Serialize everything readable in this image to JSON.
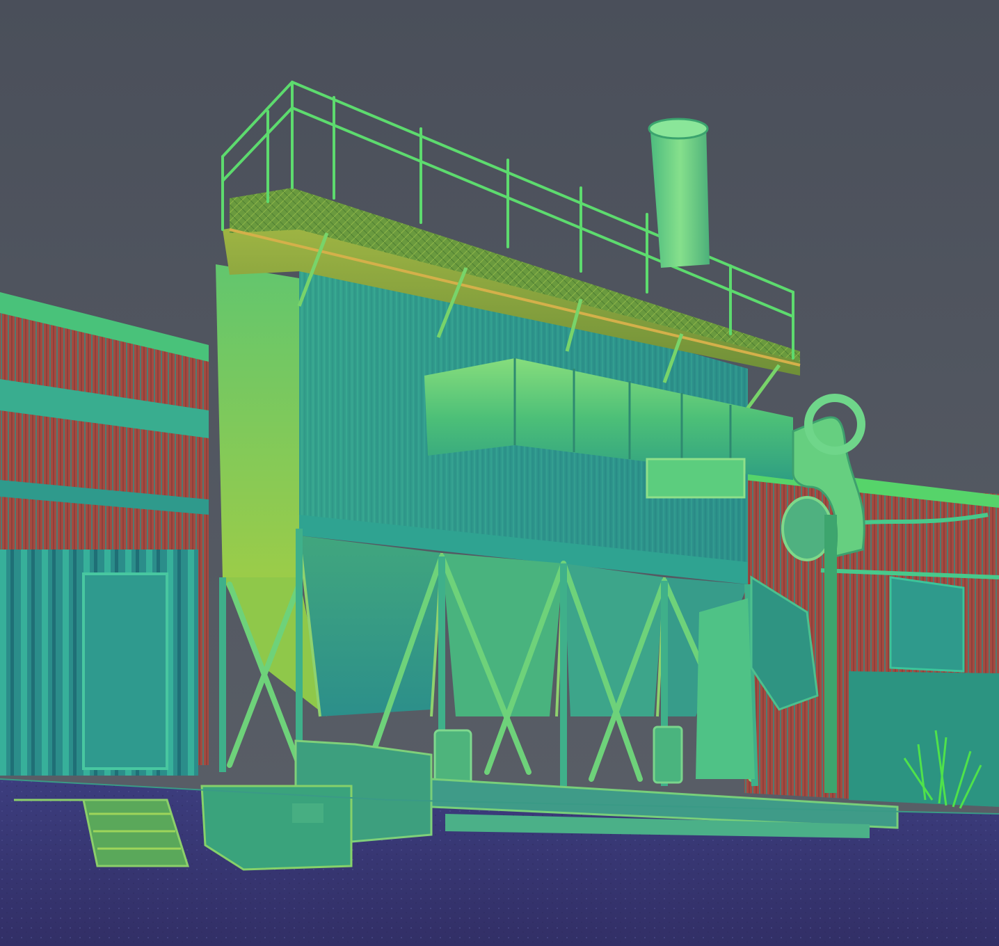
{
  "viewer": {
    "background_top": "#4b4f59",
    "background_bottom": "#5a5f68"
  },
  "scene": {
    "description_palette": {
      "ground": "#35336e",
      "ground_light": "#3e3f82",
      "wall_red": "#a8463e",
      "wall_red_dark": "#8e3a36",
      "panel_teal": "#2f9b8e",
      "panel_teal_dark": "#227a78",
      "structure_green": "#45c46a",
      "structure_light": "#7be07a",
      "rail_green": "#55d36a",
      "hopper_yellow": "#9fcf3a",
      "duct_green": "#5fd27a",
      "stack_green": "#6bd48a",
      "vegetation": "#4fe04a",
      "edge_dark": "#1f5a5c"
    }
  }
}
